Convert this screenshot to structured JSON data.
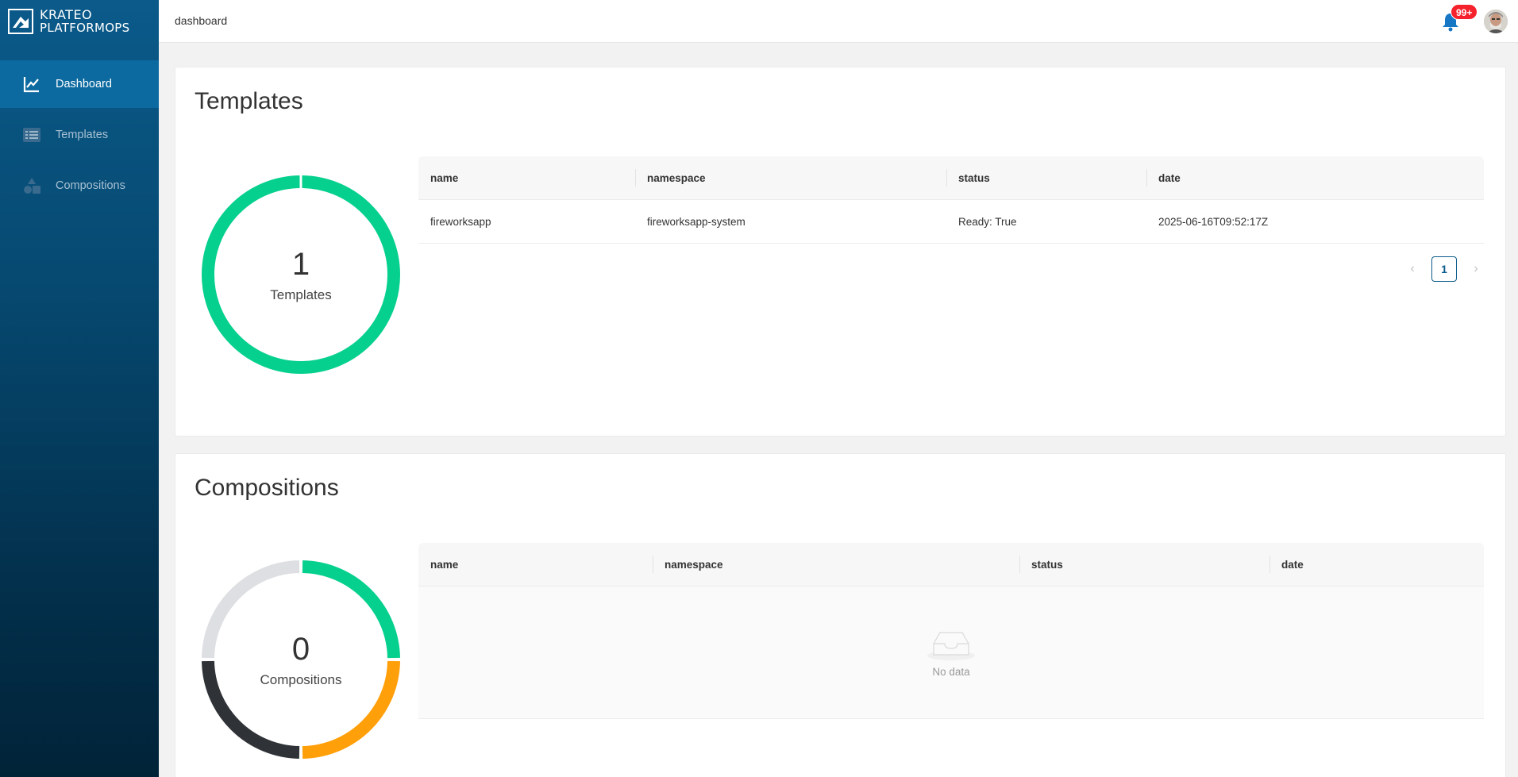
{
  "logo": {
    "line1": "KRATEO",
    "line2": "PLATFORMOPS"
  },
  "sidebar": {
    "items": [
      {
        "label": "Dashboard",
        "icon": "line-chart-icon",
        "active": true
      },
      {
        "label": "Templates",
        "icon": "list-icon",
        "active": false
      },
      {
        "label": "Compositions",
        "icon": "shapes-icon",
        "active": false
      }
    ]
  },
  "header": {
    "breadcrumb": "dashboard",
    "notifications_badge": "99+"
  },
  "templates_card": {
    "title": "Templates",
    "count": "1",
    "count_label": "Templates",
    "table": {
      "columns": [
        "name",
        "namespace",
        "status",
        "date"
      ],
      "rows": [
        {
          "name": "fireworksapp",
          "namespace": "fireworksapp-system",
          "status": "Ready: True",
          "date": "2025-06-16T09:52:17Z"
        }
      ]
    },
    "pagination": {
      "prev": "‹",
      "current": "1",
      "next": "›"
    }
  },
  "compositions_card": {
    "title": "Compositions",
    "count": "0",
    "count_label": "Compositions",
    "table": {
      "columns": [
        "name",
        "namespace",
        "status",
        "date"
      ],
      "empty_text": "No data"
    }
  },
  "colors": {
    "green": "#06d08e",
    "orange": "#ff9f0a",
    "dark": "#2f3337",
    "gray": "#dedfe3",
    "accent": "#0b5a8a"
  }
}
